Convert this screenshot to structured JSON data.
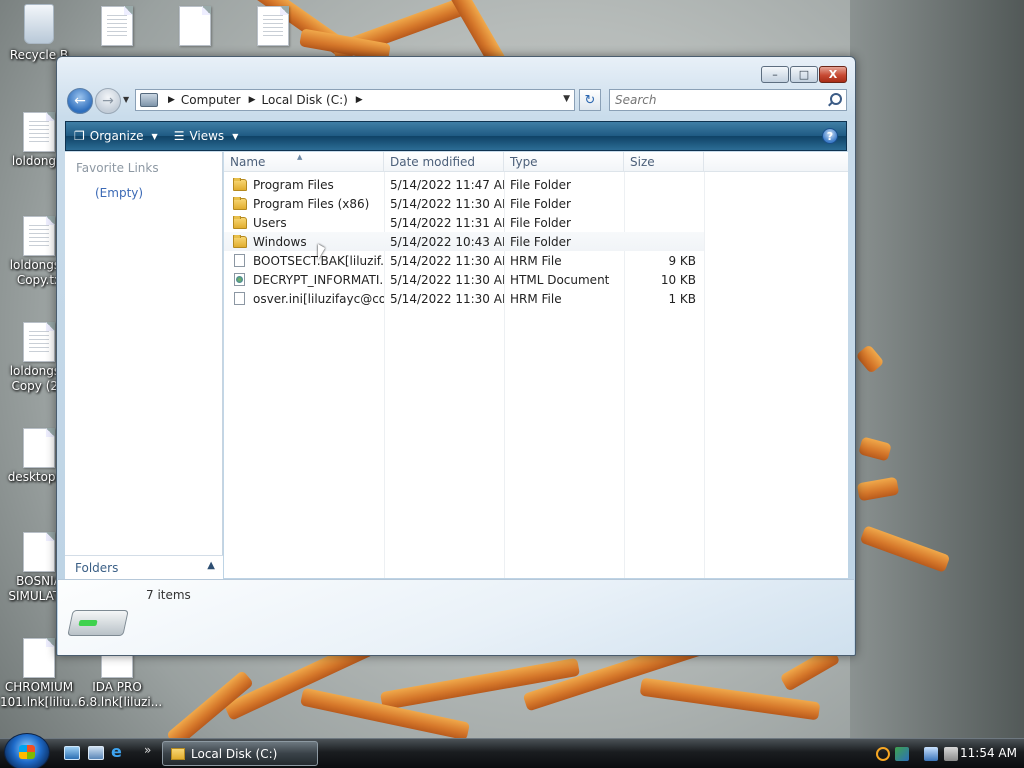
{
  "desktop": {
    "icons": [
      {
        "label": "Recycle B"
      },
      {
        "label": ""
      },
      {
        "label": ""
      },
      {
        "label": ""
      },
      {
        "label": "loldongs."
      },
      {
        "label": "loldongs - Copy.tx"
      },
      {
        "label": "loldongs - Copy (2)."
      },
      {
        "label": "desktop.in"
      },
      {
        "label": "BOSNIA SIMULATO"
      },
      {
        "label": "CHROMIUM 101.lnk[liliu..."
      },
      {
        "label": "IDA PRO 6.8.lnk[liluzi..."
      }
    ]
  },
  "window": {
    "caption_buttons": {
      "minimize": "–",
      "maximize": "□",
      "close": "X"
    },
    "address": {
      "segments": [
        "Computer",
        "Local Disk (C:)"
      ]
    },
    "search": {
      "placeholder": "Search"
    },
    "toolbar": {
      "organize": "Organize",
      "views": "Views",
      "help": "?"
    },
    "nav_pane": {
      "favorite_links_title": "Favorite Links",
      "empty_label": "(Empty)",
      "folders_label": "Folders"
    },
    "columns": {
      "name": "Name",
      "date": "Date modified",
      "type": "Type",
      "size": "Size"
    },
    "files": [
      {
        "name": "Program Files",
        "date": "5/14/2022 11:47 AM",
        "type": "File Folder",
        "size": "",
        "icon": "folder-icon"
      },
      {
        "name": "Program Files (x86)",
        "date": "5/14/2022 11:30 AM",
        "type": "File Folder",
        "size": "",
        "icon": "folder-icon"
      },
      {
        "name": "Users",
        "date": "5/14/2022 11:31 AM",
        "type": "File Folder",
        "size": "",
        "icon": "folder-icon"
      },
      {
        "name": "Windows",
        "date": "5/14/2022 10:43 AM",
        "type": "File Folder",
        "size": "",
        "icon": "folder-icon"
      },
      {
        "name": "BOOTSECT.BAK[liluzif...",
        "date": "5/14/2022 11:30 AM",
        "type": "HRM File",
        "size": "9 KB",
        "icon": "file-icon"
      },
      {
        "name": "DECRYPT_INFORMATI...",
        "date": "5/14/2022 11:30 AM",
        "type": "HTML Document",
        "size": "10 KB",
        "icon": "html-file-icon"
      },
      {
        "name": "osver.ini[liluzifayc@co...",
        "date": "5/14/2022 11:30 AM",
        "type": "HRM File",
        "size": "1 KB",
        "icon": "file-icon"
      }
    ],
    "details": {
      "item_count": "7 items"
    }
  },
  "taskbar": {
    "task_label": "Local Disk (C:)",
    "quicklaunch_more": "»",
    "clock": "11:54 AM"
  }
}
